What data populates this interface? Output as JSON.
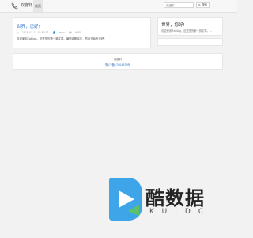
{
  "header": {
    "site_name": "双鹿轩",
    "nav": [
      {
        "label": "首页"
      }
    ],
    "search": {
      "placeholder": "关键字",
      "button_label": "搜索",
      "icon": "search-icon"
    }
  },
  "post": {
    "title": "世界，您好!",
    "date": "2018-01-17 15:42:11",
    "author": "wlkz",
    "views": "9080",
    "excerpt": "欢迎使用ZaBlog。这是您的第一篇文章。编辑或删除它，然后开始写作吧!"
  },
  "sidebar": {
    "latest": {
      "title": "世界，您好!",
      "text": "欢迎使用ZaBlog。这是您的第一篇文章。..."
    }
  },
  "footer": {
    "site_name": "双鹿轩",
    "icp": "豫ICP备17004839号"
  },
  "watermark": {
    "title": "酷数据",
    "subtitle": "KUIDC",
    "colors": {
      "blue": "#3ea6e8",
      "green": "#5cc16a",
      "dark": "#252525"
    }
  }
}
